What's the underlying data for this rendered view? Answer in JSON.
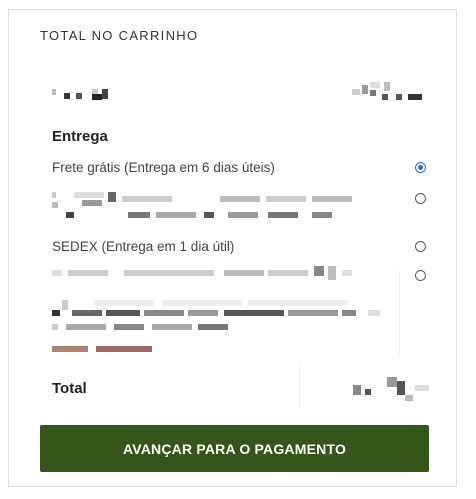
{
  "cart": {
    "title": "TOTAL NO CARRINHO",
    "shipping_label": "Entrega",
    "options": [
      {
        "label": "Frete grátis (Entrega em 6 dias úteis)",
        "selected": true
      },
      {
        "label": "",
        "selected": false
      },
      {
        "label": "SEDEX (Entrega em 1 dia útil)",
        "selected": false
      },
      {
        "label": "",
        "selected": false
      }
    ],
    "total_label": "Total",
    "checkout_button": "AVANÇAR PARA O PAGAMENTO"
  },
  "colors": {
    "button_bg": "#34561a",
    "radio_selected": "#2a6de0"
  }
}
